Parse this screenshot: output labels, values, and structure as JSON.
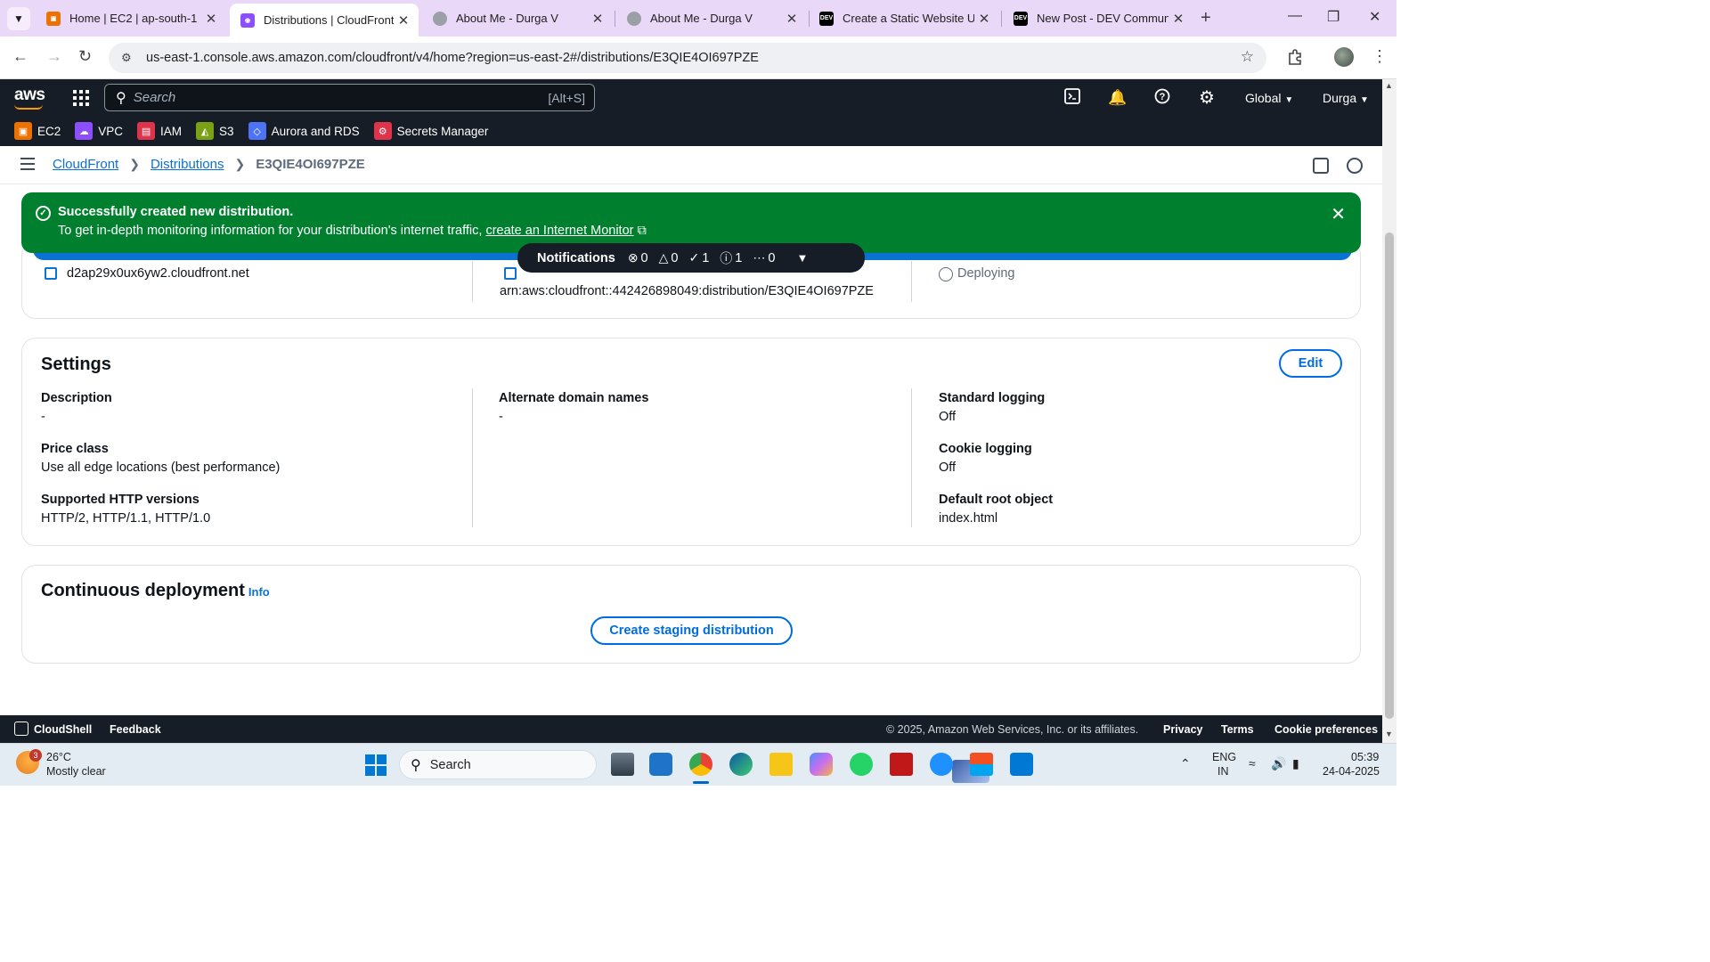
{
  "browser": {
    "tabs": [
      {
        "title": "Home | EC2 | ap-south-1",
        "icon": "ec2-favicon",
        "color": "#ed7100"
      },
      {
        "title": "Distributions | CloudFront | Global",
        "icon": "cloudfront-favicon",
        "color": "#8c4fff"
      },
      {
        "title": "About Me - Durga V",
        "icon": "globe-favicon",
        "color": "#9aa0a6"
      },
      {
        "title": "About Me - Durga V",
        "icon": "globe-favicon",
        "color": "#9aa0a6"
      },
      {
        "title": "Create a Static Website Using",
        "icon": "dev-favicon",
        "color": "#000000"
      },
      {
        "title": "New Post - DEV Community",
        "icon": "dev-favicon",
        "color": "#000000"
      }
    ],
    "dev_favicon_text": "DEV",
    "url": "us-east-1.console.aws.amazon.com/cloudfront/v4/home?region=us-east-2#/distributions/E3QIE4OI697PZE"
  },
  "aws_header": {
    "logo": "aws",
    "search_placeholder": "Search",
    "search_shortcut": "[Alt+S]",
    "region_menu": "Global",
    "user_menu": "Durga",
    "favorites": [
      {
        "label": "EC2",
        "color": "#ed7100"
      },
      {
        "label": "VPC",
        "color": "#8c4fff"
      },
      {
        "label": "IAM",
        "color": "#dd344c"
      },
      {
        "label": "S3",
        "color": "#7aa116"
      },
      {
        "label": "Aurora and RDS",
        "color": "#4d72f3"
      },
      {
        "label": "Secrets Manager",
        "color": "#dd344c"
      }
    ]
  },
  "breadcrumb": {
    "items": [
      "CloudFront",
      "Distributions"
    ],
    "current": "E3QIE4OI697PZE"
  },
  "flash": {
    "header": "Successfully created new distribution.",
    "body": "To get in-depth monitoring information for your distribution's internet traffic,",
    "link": "create an Internet Monitor",
    "color": "#00802f"
  },
  "notifications": {
    "label": "Notifications",
    "error_count": "0",
    "warning_count": "0",
    "success_count": "1",
    "info_count": "1",
    "in_progress_count": "0"
  },
  "details": {
    "domain_name": "d2ap29x0ux6yw2.cloudfront.net",
    "arn": "arn:aws:cloudfront::442426898049:distribution/E3QIE4OI697PZE",
    "status": "Deploying"
  },
  "settings": {
    "title": "Settings",
    "edit_label": "Edit",
    "col1": [
      {
        "label": "Description",
        "value": "-"
      },
      {
        "label": "Price class",
        "value": "Use all edge locations (best performance)"
      },
      {
        "label": "Supported HTTP versions",
        "value": "HTTP/2, HTTP/1.1, HTTP/1.0"
      }
    ],
    "col2": [
      {
        "label": "Alternate domain names",
        "value": "-"
      }
    ],
    "col3": [
      {
        "label": "Standard logging",
        "value": "Off"
      },
      {
        "label": "Cookie logging",
        "value": "Off"
      },
      {
        "label": "Default root object",
        "value": "index.html"
      }
    ]
  },
  "continuous_deployment": {
    "title": "Continuous deployment",
    "info": "Info",
    "button": "Create staging distribution"
  },
  "footer": {
    "cloudshell": "CloudShell",
    "feedback": "Feedback",
    "copyright": "© 2025, Amazon Web Services, Inc. or its affiliates.",
    "privacy": "Privacy",
    "terms": "Terms",
    "cookie": "Cookie preferences"
  },
  "taskbar": {
    "weather_badge": "3",
    "temperature": "26°C",
    "weather": "Mostly clear",
    "search": "Search",
    "lang1": "ENG",
    "lang2": "IN",
    "time": "05:39",
    "date": "24-04-2025"
  }
}
